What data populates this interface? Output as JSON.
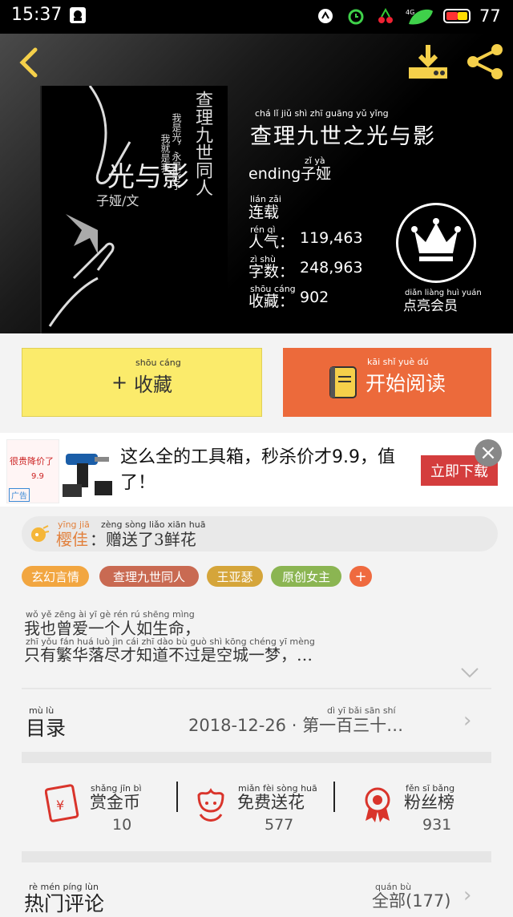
{
  "status": {
    "time": "15:37",
    "battery": "77",
    "network": "4G"
  },
  "book": {
    "title": "查理九世之光与影",
    "title_pinyin": "chá  lǐ  jiǔ  shì  zhī guāng yǔ  yǐng",
    "author": "ending子娅",
    "author_pinyin": "zǐ  yà",
    "status_label": "连载",
    "status_pinyin": "lián zǎi",
    "popularity_label": "人气：",
    "popularity_pinyin": "rén qì",
    "popularity_value": "119,463",
    "words_label": "字数：",
    "words_pinyin": "zì  shù",
    "words_value": "248,963",
    "favorites_label": "收藏：",
    "favorites_pinyin": "shōu cáng",
    "favorites_value": "902",
    "member_label": "点亮会员",
    "member_pinyin": "diǎn liàng huì yuán",
    "cover_lines": [
      "查理九世同人",
      "我是光，永是影子",
      "我就是我"
    ],
    "cover_title": "光与影",
    "cover_author": "子娅/文"
  },
  "actions": {
    "favorite_label": "收藏",
    "favorite_pinyin": "shōu cáng",
    "read_label": "开始阅读",
    "read_pinyin": "kāi  shǐ  yuè  dú"
  },
  "ad": {
    "text": "这么全的工具箱，秒杀价才9.9，值了！",
    "button": "立即下载",
    "badge": "广告",
    "promo": "很贵降价了",
    "price": "9.9"
  },
  "gift": {
    "user": "樱佳",
    "user_pinyin": "yīng jiā",
    "message": "：赠送了3鲜花",
    "message_pinyin": "zèng sòng liǎo   xiān huā"
  },
  "tags": [
    {
      "label": "玄幻言情",
      "pinyin": "xuán huàn yán qíng",
      "color": "#f2a640"
    },
    {
      "label": "查理九世同人",
      "pinyin": "chá lǐ jiǔ shì tóng rén",
      "color": "#c96a52"
    },
    {
      "label": "王亚瑟",
      "pinyin": "wáng yà sè",
      "color": "#d5a53a"
    },
    {
      "label": "原创女主",
      "pinyin": "yuán chuàng nǚ zhǔ",
      "color": "#8bb552"
    },
    {
      "label": "+",
      "pinyin": "",
      "color": "#ef6a3f"
    }
  ],
  "intro": {
    "line1": "我也曾爱一个人如生命，",
    "line1_pinyin": "wǒ  yě zēng  ài   yī   gè  rén  rú shēng mìng",
    "line2": "只有繁华落尽才知道不过是空城一梦，…",
    "line2_pinyin": "zhī  yǒu  fán  huá  luò  jìn  cái  zhī  dào  bù  guò  shì kōng chéng yī  mèng"
  },
  "catalog": {
    "label": "目录",
    "label_pinyin": "mù  lù",
    "latest": "2018-12-26 · 第一百三十…",
    "latest_pinyin": "dì   yī  bǎi  sān  shí"
  },
  "stats": [
    {
      "label": "赏金币",
      "pinyin": "shǎng jīn bì",
      "value": "10"
    },
    {
      "label": "免费送花",
      "pinyin": "miǎn fèi sòng huā",
      "value": "577"
    },
    {
      "label": "粉丝榜",
      "pinyin": "fěn  sī  bǎng",
      "value": "931"
    }
  ],
  "comments": {
    "label": "热门评论",
    "label_pinyin": "rè  mén píng lùn",
    "all": "全部(177)",
    "all_pinyin": "quán  bù"
  },
  "colors": {
    "accent": "#ec6a3b",
    "favorite_bg": "#fbeb6b",
    "icon_yellow": "#f5d04a",
    "icon_red": "#d9342b"
  }
}
